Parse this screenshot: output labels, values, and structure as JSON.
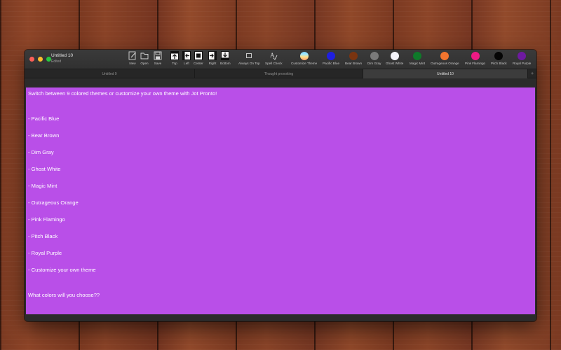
{
  "window": {
    "title": "Untitled 10",
    "status": "Edited"
  },
  "toolbar": {
    "tools": [
      {
        "id": "new",
        "label": "New",
        "icon": "new-document-icon"
      },
      {
        "id": "open",
        "label": "Open",
        "icon": "folder-icon"
      },
      {
        "id": "save",
        "label": "Save",
        "icon": "save-icon"
      },
      {
        "id": "top",
        "label": "Top",
        "icon": "align-top-icon"
      },
      {
        "id": "left",
        "label": "Left",
        "icon": "align-left-icon"
      },
      {
        "id": "center",
        "label": "Center",
        "icon": "align-center-icon"
      },
      {
        "id": "right",
        "label": "Right",
        "icon": "align-right-icon"
      },
      {
        "id": "bottom",
        "label": "Bottom",
        "icon": "align-bottom-icon"
      },
      {
        "id": "always_on_top",
        "label": "Always On Top",
        "icon": "window-icon"
      },
      {
        "id": "spell_check",
        "label": "Spell Check",
        "icon": "spell-check-icon"
      }
    ],
    "themes": [
      {
        "label": "Customize Theme",
        "color": "rainbow"
      },
      {
        "label": "Pacific Blue",
        "color": "#1f1fe0"
      },
      {
        "label": "Bear Brown",
        "color": "#7a3410"
      },
      {
        "label": "Dim Gray",
        "color": "#7a7a7a"
      },
      {
        "label": "Ghost White",
        "color": "#f4f4fa"
      },
      {
        "label": "Magic Mint",
        "color": "#0f7a2a"
      },
      {
        "label": "Outrageous Orange",
        "color": "#f2752e"
      },
      {
        "label": "Pink Flamingo",
        "color": "#ee1a84"
      },
      {
        "label": "Pitch Black",
        "color": "#050505"
      },
      {
        "label": "Royal Purple",
        "color": "#6e1aa0"
      }
    ]
  },
  "tabs": [
    {
      "label": "Untitled 9",
      "active": false
    },
    {
      "label": "Thought provoking",
      "active": false
    },
    {
      "label": "Untitled 10",
      "active": true
    }
  ],
  "tab_add_label": "+",
  "editor": {
    "background": "#b94fe8",
    "text_color": "#ffffff",
    "lines": [
      "Switch between 9 colored themes or customize your own theme with Jot Pronto!",
      "",
      "",
      "- Pacific Blue",
      "",
      "- Bear Brown",
      "",
      "- Dim Gray",
      "",
      "- Ghost White",
      "",
      "- Magic Mint",
      "",
      "- Outrageous Orange",
      "",
      "- Pink Flamingo",
      "",
      "- Pitch Black",
      "",
      "- Royal Purple",
      "",
      "- Customize your own theme",
      "",
      "",
      "What colors will you choose??"
    ]
  }
}
